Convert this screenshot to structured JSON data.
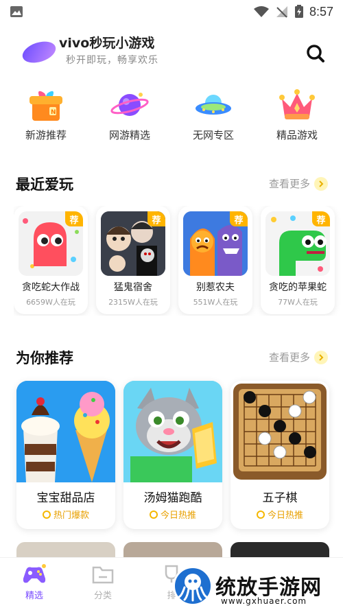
{
  "status_bar": {
    "time": "8:57"
  },
  "header": {
    "title": "vivo秒玩小游戏",
    "subtitle": "秒开即玩，畅享欢乐"
  },
  "categories": [
    {
      "label": "新游推荐",
      "icon": "gift-box-icon"
    },
    {
      "label": "网游精选",
      "icon": "planet-icon"
    },
    {
      "label": "无网专区",
      "icon": "ufo-icon"
    },
    {
      "label": "精品游戏",
      "icon": "crown-icon"
    }
  ],
  "recent": {
    "title": "最近爱玩",
    "more_label": "查看更多",
    "badge": "荐",
    "items": [
      {
        "name": "贪吃蛇大作战",
        "plays": "6659W人在玩"
      },
      {
        "name": "猛鬼宿舍",
        "plays": "2315W人在玩"
      },
      {
        "name": "别惹农夫",
        "plays": "551W人在玩"
      },
      {
        "name": "贪吃的苹果蛇",
        "plays": "77W人在玩"
      }
    ]
  },
  "recommend": {
    "title": "为你推荐",
    "more_label": "查看更多",
    "items": [
      {
        "name": "宝宝甜品店",
        "tag": "热门爆款"
      },
      {
        "name": "汤姆猫跑酷",
        "tag": "今日热推"
      },
      {
        "name": "五子棋",
        "tag": "今日热推"
      }
    ]
  },
  "tabbar": {
    "items": [
      {
        "label": "精选",
        "active": true
      },
      {
        "label": "分类",
        "active": false
      },
      {
        "label": "排",
        "active": false
      }
    ]
  },
  "watermark": {
    "text": "统放手游网",
    "url": "www.gxhuaer.com"
  },
  "colors": {
    "accent": "#7a4cff",
    "badge": "#ffb400",
    "hot_tag": "#e8a000"
  }
}
